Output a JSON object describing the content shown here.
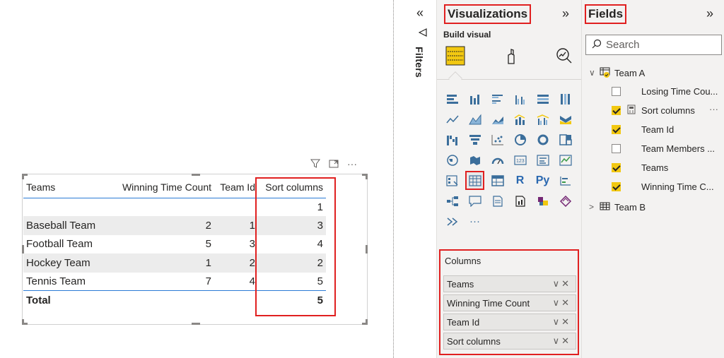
{
  "table": {
    "headers": [
      "Teams",
      "Winning Time Count",
      "Team Id",
      "Sort columns"
    ],
    "rows": [
      [
        "",
        "",
        "",
        "1"
      ],
      [
        "Baseball Team",
        "2",
        "1",
        "3"
      ],
      [
        "Football Team",
        "5",
        "3",
        "4"
      ],
      [
        "Hockey Team",
        "1",
        "2",
        "2"
      ],
      [
        "Tennis Team",
        "7",
        "4",
        "5"
      ]
    ],
    "total": [
      "Total",
      "",
      "",
      "5"
    ]
  },
  "visual_header": {
    "filter_icon": "filter-icon",
    "focus_icon": "focus-mode-icon",
    "more": "···"
  },
  "filters_pane": {
    "label": "Filters",
    "collapse": "«"
  },
  "visualizations": {
    "title": "Visualizations",
    "collapse": "»",
    "build_visual": "Build visual",
    "gallery_text": {
      "r": "R",
      "py": "Py",
      "more": "···"
    },
    "columns_label": "Columns",
    "wells": [
      "Teams",
      "Winning Time Count",
      "Team Id",
      "Sort columns"
    ],
    "well_controls": "∨✕"
  },
  "fields": {
    "title": "Fields",
    "collapse": "»",
    "search_placeholder": "Search",
    "team_a": "Team A",
    "team_a_fields": [
      {
        "label": "Losing Time Cou...",
        "checked": false
      },
      {
        "label": "Sort columns",
        "checked": true
      },
      {
        "label": "Team Id",
        "checked": true
      },
      {
        "label": "Team Members ...",
        "checked": false
      },
      {
        "label": "Teams",
        "checked": true
      },
      {
        "label": "Winning Time C...",
        "checked": true
      }
    ],
    "team_b": "Team B",
    "more": "···"
  },
  "colors": {
    "accent_yellow": "#f2c811",
    "highlight_red": "#e02020",
    "divider_blue": "#2a7bd6"
  }
}
